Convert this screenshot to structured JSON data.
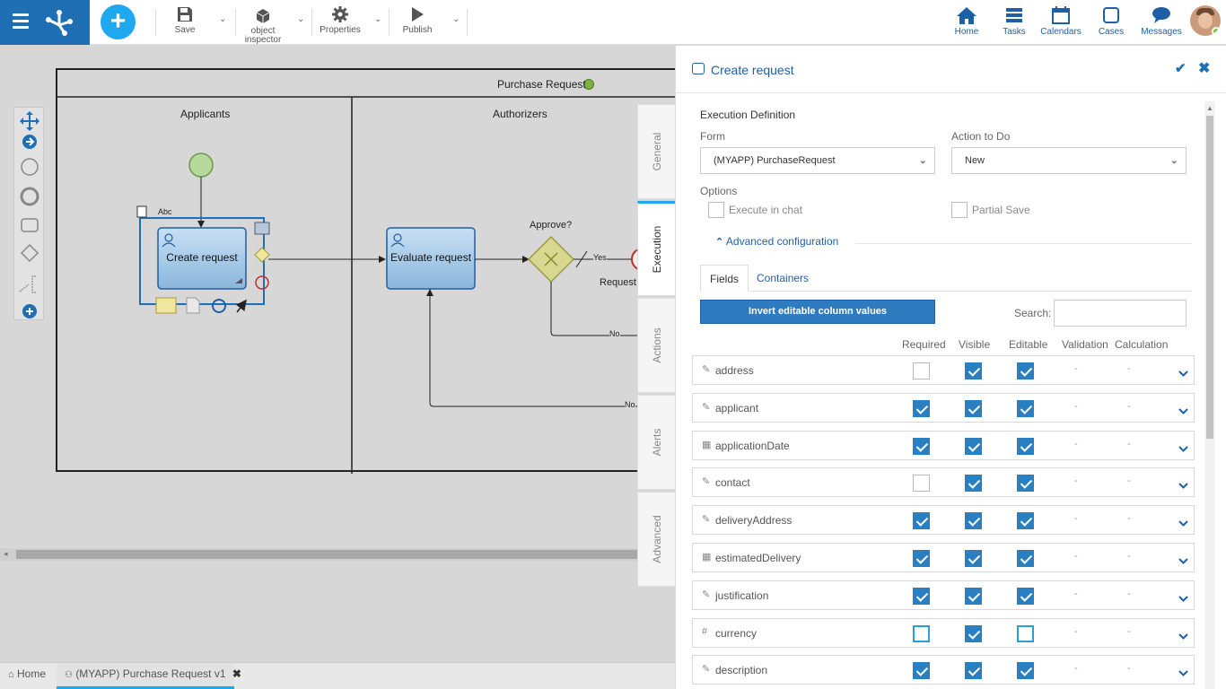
{
  "toolbar": {
    "save_label": "Save",
    "object_inspector_label_1": "object",
    "object_inspector_label_2": "inspector",
    "properties_label": "Properties",
    "publish_label": "Publish"
  },
  "nav": {
    "home": "Home",
    "tasks": "Tasks",
    "calendars": "Calendars",
    "cases": "Cases",
    "messages": "Messages"
  },
  "diagram": {
    "pool_title": "Purchase Request",
    "lane_1": "Applicants",
    "lane_2": "Authorizers",
    "task_1": "Create request",
    "task_2": "Evaluate request",
    "gateway_label": "Approve?",
    "flow_yes": "Yes",
    "flow_no_1": "No",
    "flow_no_2": "No",
    "partial_label": "Request",
    "text_tool": "Abc"
  },
  "vertical_tabs": [
    "General",
    "Execution",
    "Actions",
    "Alerts",
    "Advanced"
  ],
  "bottom_tabs": {
    "home": "Home",
    "document": "(MYAPP) Purchase Request v1"
  },
  "panel": {
    "title": "Create request",
    "execution_definition": "Execution Definition",
    "form_label": "Form",
    "form_value": "(MYAPP) PurchaseRequest",
    "action_label": "Action to Do",
    "action_value": "New",
    "options_label": "Options",
    "execute_in_chat": "Execute in chat",
    "partial_save": "Partial Save",
    "advanced_configuration": "Advanced configuration",
    "tab_fields": "Fields",
    "tab_containers": "Containers",
    "invert_button": "Invert editable column values",
    "search_label": "Search:",
    "columns": [
      "Required",
      "Visible",
      "Editable",
      "Validation",
      "Calculation"
    ],
    "rows": [
      {
        "name": "address",
        "icon": "edit-icon",
        "required": false,
        "visible": true,
        "editable": true,
        "validation": "-",
        "calculation": "-"
      },
      {
        "name": "applicant",
        "icon": "edit-icon",
        "required": true,
        "visible": true,
        "editable": true,
        "validation": "-",
        "calculation": "-"
      },
      {
        "name": "applicationDate",
        "icon": "calendar-icon",
        "required": true,
        "visible": true,
        "editable": true,
        "validation": "-",
        "calculation": "-"
      },
      {
        "name": "contact",
        "icon": "edit-icon",
        "required": false,
        "visible": true,
        "editable": true,
        "validation": "-",
        "calculation": "-"
      },
      {
        "name": "deliveryAddress",
        "icon": "edit-icon",
        "required": true,
        "visible": true,
        "editable": true,
        "validation": "-",
        "calculation": "-"
      },
      {
        "name": "estimatedDelivery",
        "icon": "calendar-icon",
        "required": true,
        "visible": true,
        "editable": true,
        "validation": "-",
        "calculation": "-"
      },
      {
        "name": "justification",
        "icon": "edit-icon",
        "required": true,
        "visible": true,
        "editable": true,
        "validation": "-",
        "calculation": "-"
      },
      {
        "name": "currency",
        "icon": "hash-icon",
        "required": false,
        "visible": true,
        "editable": false,
        "validation": "-",
        "calculation": "-"
      },
      {
        "name": "description",
        "icon": "edit-icon",
        "required": true,
        "visible": true,
        "editable": true,
        "validation": "-",
        "calculation": "-"
      }
    ]
  }
}
